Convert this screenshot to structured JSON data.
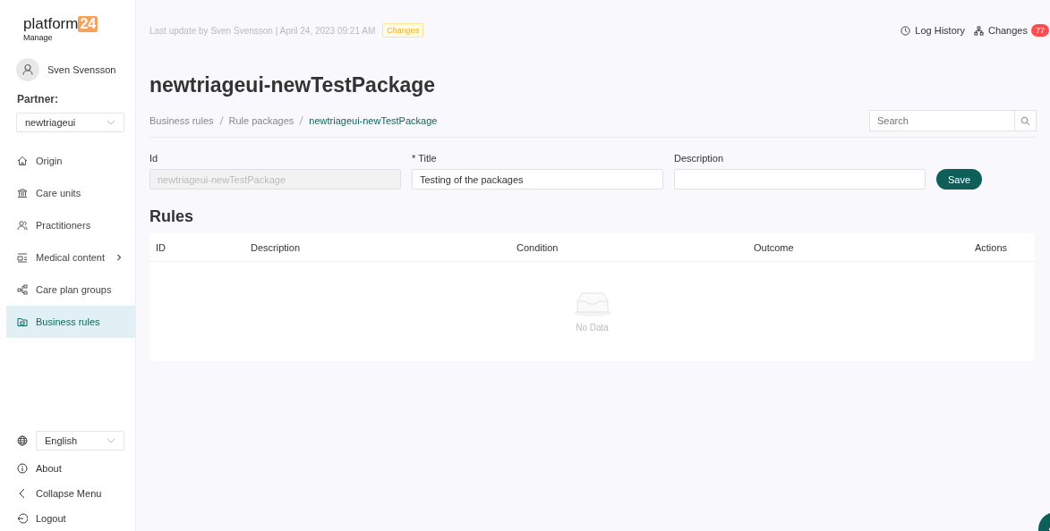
{
  "logo": {
    "name": "platform",
    "badge": "24",
    "subtitle": "Manage"
  },
  "user": {
    "name": "Sven Svensson"
  },
  "partner": {
    "label": "Partner:",
    "value": "newtriageui"
  },
  "nav": [
    {
      "label": "Origin",
      "kind": "home",
      "selected": false,
      "expandable": false
    },
    {
      "label": "Care units",
      "kind": "bank",
      "selected": false,
      "expandable": false
    },
    {
      "label": "Practitioners",
      "kind": "people",
      "selected": false,
      "expandable": false
    },
    {
      "label": "Medical content",
      "kind": "list",
      "selected": false,
      "expandable": true
    },
    {
      "label": "Care plan groups",
      "kind": "nodes",
      "selected": false,
      "expandable": false
    },
    {
      "label": "Business rules",
      "kind": "folder",
      "selected": true,
      "expandable": false
    }
  ],
  "language": {
    "value": "English"
  },
  "footer_links": [
    {
      "label": "About",
      "kind": "info"
    },
    {
      "label": "Collapse Menu",
      "kind": "collapse"
    },
    {
      "label": "Logout",
      "kind": "logout"
    }
  ],
  "top_bar": {
    "last_update": "Last update by Sven Svensson | April 24, 2023 09:21 AM",
    "changes_tag": "Changes",
    "log_history": "Log History",
    "changes": "Changes",
    "changes_count": "77"
  },
  "page_title": "newtriageui-newTestPackage",
  "breadcrumb": [
    "Business rules",
    "Rule packages",
    "newtriageui-newTestPackage"
  ],
  "search": {
    "placeholder": "Search"
  },
  "form": {
    "fields": [
      {
        "label": "Id",
        "value": "newtriageui-newTestPackage",
        "disabled": true
      },
      {
        "label": "* Title",
        "value": "Testing of the packages",
        "disabled": false
      },
      {
        "label": "Description",
        "disabled": false
      }
    ],
    "save": "Save"
  },
  "rules": {
    "heading": "Rules",
    "columns": [
      "ID",
      "Description",
      "Condition",
      "Outcome",
      "Actions"
    ],
    "empty_text": "No Data"
  }
}
